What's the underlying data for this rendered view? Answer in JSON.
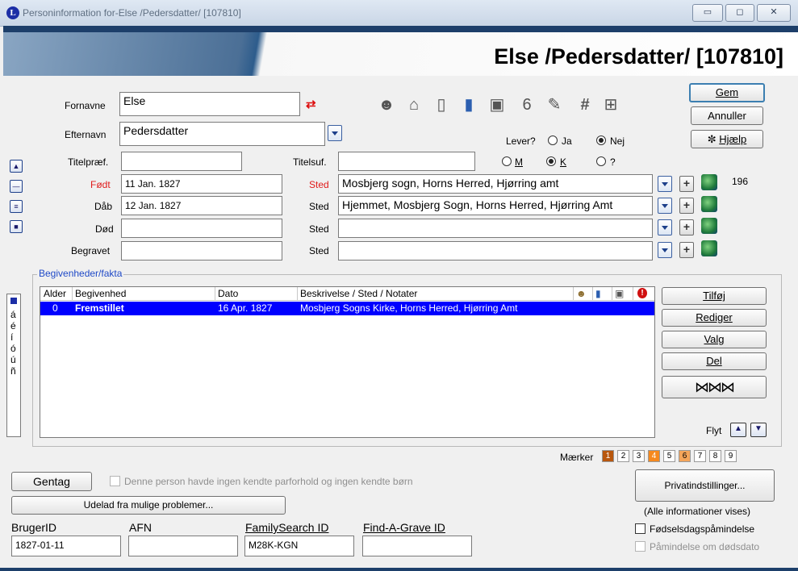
{
  "window": {
    "title": "Personinformation for-Else /Pedersdatter/ [107810]",
    "app_icon": "L",
    "heading": "Else /Pedersdatter/ [107810]",
    "min_label": "▭",
    "max_label": "◻",
    "close_label": "✕"
  },
  "form": {
    "fornavn_label": "Fornavne",
    "fornavn_value": "Else",
    "efternavn_label": "Efternavn",
    "efternavn_value": "Pedersdatter",
    "titelpraef_label": "Titelpræf.",
    "titelpraef_value": "",
    "titelsuf_label": "Titelsuf.",
    "titelsuf_value": "",
    "lever_label": "Lever?",
    "ja_label": "Ja",
    "nej_label": "Nej",
    "m_label": "M",
    "k_label": "K",
    "q_label": "?",
    "fodt_label": "Født",
    "fodt_value": "11 Jan. 1827",
    "fodt_sted_label": "Sted",
    "fodt_sted_value": "Mosbjerg sogn, Horns Herred, Hjørring amt",
    "fodt_number": "196",
    "daab_label": "Dåb",
    "daab_value": "12 Jan. 1827",
    "daab_sted_label": "Sted",
    "daab_sted_value": "Hjemmet, Mosbjerg Sogn, Horns Herred, Hjørring Amt",
    "dod_label": "Død",
    "dod_value": "",
    "dod_sted_label": "Sted",
    "dod_sted_value": "",
    "begravet_label": "Begravet",
    "begravet_value": "",
    "begravet_sted_label": "Sted",
    "begravet_sted_value": ""
  },
  "buttons": {
    "gem": "Gem",
    "annuller": "Annuller",
    "hjaelp": "Hjælp",
    "tilfoj": "Tilføj",
    "rediger": "Rediger",
    "valg": "Valg",
    "del": "Del",
    "flyt": "Flyt",
    "gentag": "Gentag",
    "udelad": "Udelad fra mulige problemer...",
    "privat": "Privatindstillinger..."
  },
  "events": {
    "group_title": "Begivenheder/fakta",
    "columns": [
      "Alder",
      "Begivenhed",
      "Dato",
      "Beskrivelse / Sted / Notater"
    ],
    "rows": [
      {
        "alder": "0",
        "begivenhed": "Fremstillet",
        "dato": "16 Apr. 1827",
        "beskrivelse": "Mosbjerg Sogns Kirke, Horns Herred, Hjørring Amt"
      }
    ]
  },
  "side_chars": [
    "á",
    "é",
    "í",
    "ó",
    "ú",
    "ñ"
  ],
  "markers": {
    "label": "Mærker",
    "items": [
      "1",
      "2",
      "3",
      "4",
      "5",
      "6",
      "7",
      "8",
      "9"
    ],
    "colors": {
      "1": "#b8570e",
      "4": "#f5891f",
      "6": "#f5a55a"
    }
  },
  "bottom": {
    "no_partner_text": "Denne person havde ingen kendte parforhold og ingen kendte børn",
    "all_info": "(Alle informationer vises)",
    "birthday_reminder": "Fødselsdagspåmindelse",
    "death_reminder": "Påmindelse om dødsdato",
    "brugerid_label": "BrugerID",
    "brugerid_value": "1827-01-11",
    "afn_label": "AFN",
    "afn_value": "",
    "familysearch_label": "FamilySearch ID",
    "familysearch_value": "M28K-KGN",
    "findagrave_label": "Find-A-Grave ID",
    "findagrave_value": ""
  },
  "icons": [
    "people-icon",
    "house-icon",
    "page-icon",
    "book-icon",
    "photo-icon",
    "calendar-icon",
    "notes-icon",
    "hash-icon",
    "open-book-icon"
  ]
}
